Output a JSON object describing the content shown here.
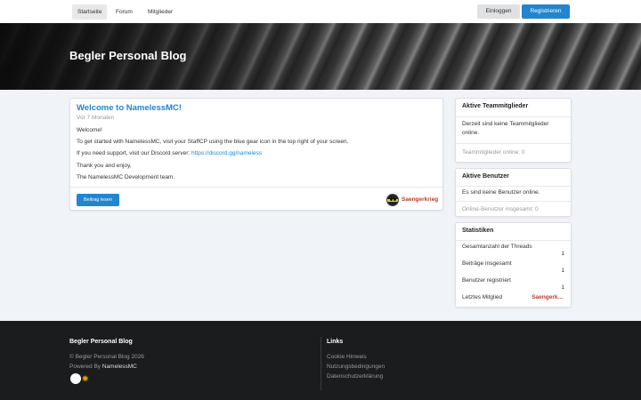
{
  "nav": {
    "home": "Startseite",
    "forum": "Forum",
    "members": "Mitglieder",
    "login": "Einloggen",
    "register": "Registrieren"
  },
  "banner": {
    "title": "Begler Personal Blog"
  },
  "post": {
    "title": "Welcome to NamelessMC!",
    "time": "Vor 7 Monaten",
    "line1": "Welcome!",
    "line2": "To get started with NamelessMC, visit your StaffCP using the blue gear icon in the top right of your screen.",
    "line3_prefix": "If you need support, visit our Discord server: ",
    "line3_link": "https://discord.gg/nameless",
    "line4": "Thank you and enjoy,",
    "line5": "The NamelessMC Development team.",
    "read_button": "Beitrag lesen",
    "author": "Saengerkrieg"
  },
  "sidebar": {
    "staff": {
      "title": "Aktive Teammitglieder",
      "text": "Derzeit sind keine Teammitglieder online.",
      "footer": "Teammitglieder online: 0"
    },
    "users": {
      "title": "Aktive Benutzer",
      "text": "Es sind keine Benutzer online.",
      "footer": "Online-Benutzer insgesamt: 0"
    },
    "stats": {
      "title": "Statistiken",
      "threads_label": "Gesamtanzahl der Threads",
      "threads_value": "1",
      "posts_label": "Beiträge insgesamt",
      "posts_value": "1",
      "users_label": "Benutzer registriert",
      "users_value": "1",
      "latest_label": "Letztes Mitglied",
      "latest_value": "Saengerk…"
    }
  },
  "footer": {
    "site_title": "Begler Personal Blog",
    "copyright": "© Begler Personal Blog 2026",
    "powered_prefix": "Powered By ",
    "powered_name": "NamelessMC",
    "links_title": "Links",
    "links": [
      "Cookie Hinweis",
      "Nutzungsbedingungen",
      "Datenschutzerklärung"
    ]
  },
  "colors": {
    "accent": "#2185d0",
    "author": "#c0392b",
    "footer_bg": "#1b1c1d"
  }
}
